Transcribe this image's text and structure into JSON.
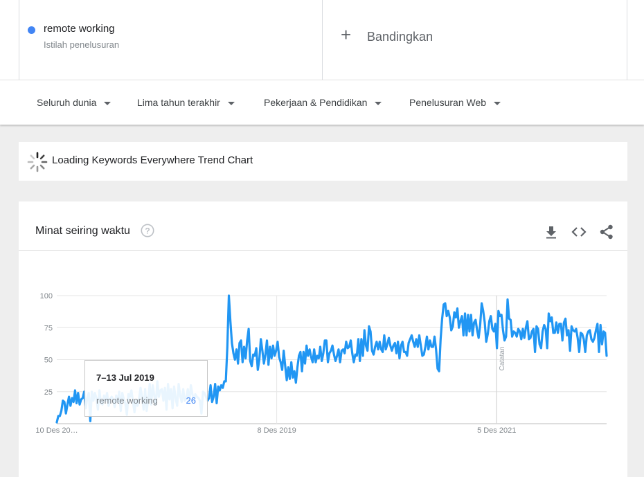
{
  "search_term": {
    "name": "remote working",
    "subtitle": "Istilah penelusuran",
    "dot_color": "#4285f4"
  },
  "compare": {
    "label": "Bandingkan",
    "icon": "plus-icon"
  },
  "filters": [
    {
      "label": "Seluruh dunia"
    },
    {
      "label": "Lima tahun terakhir"
    },
    {
      "label": "Pekerjaan & Pendidikan"
    },
    {
      "label": "Penelusuran Web"
    }
  ],
  "extension_banner": {
    "text": "Loading Keywords Everywhere Trend Chart",
    "icon": "loading-spinner-icon"
  },
  "chart_card": {
    "title": "Minat seiring waktu",
    "help_icon": "help-icon",
    "actions": [
      "download-icon",
      "embed-code-icon",
      "share-icon"
    ]
  },
  "tooltip": {
    "date": "7–13 Jul 2019",
    "term": "remote working",
    "value": "26"
  },
  "chart_data": {
    "type": "line",
    "title": "",
    "xlabel": "",
    "ylabel": "",
    "ylim": [
      0,
      100
    ],
    "yticks": [
      25,
      50,
      75,
      100
    ],
    "x_tick_labels": [
      "10 Des 20…",
      "8 Des 2019",
      "5 Des 2021"
    ],
    "x_start": "2017-12-10",
    "x_end": "2022-12-04",
    "note_label": "Catatan",
    "note_date": "2021-12-05",
    "grid": true,
    "line_color": "#2196f3",
    "series": [
      {
        "name": "remote working",
        "values": [
          1,
          6,
          6,
          10,
          18,
          17,
          8,
          15,
          21,
          14,
          20,
          17,
          26,
          16,
          24,
          15,
          19,
          20,
          25,
          12,
          20,
          24,
          2,
          25,
          18,
          24,
          20,
          11,
          26,
          16,
          15,
          22,
          18,
          24,
          14,
          19,
          21,
          19,
          13,
          22,
          17,
          25,
          10,
          24,
          19,
          16,
          7,
          23,
          21,
          26,
          17,
          9,
          18,
          14,
          19,
          28,
          21,
          11,
          27,
          10,
          19,
          31,
          15,
          30,
          22,
          15,
          33,
          21,
          26,
          27,
          18,
          28,
          11,
          31,
          19,
          27,
          12,
          29,
          20,
          14,
          31,
          22,
          17,
          27,
          18,
          20,
          27,
          16,
          30,
          23,
          18,
          23,
          21,
          20,
          18,
          8,
          25,
          24,
          21,
          18,
          20,
          30,
          17,
          21,
          31,
          16,
          29,
          26,
          30,
          28,
          33,
          33,
          60,
          100,
          80,
          63,
          55,
          50,
          58,
          47,
          63,
          65,
          48,
          60,
          51,
          65,
          74,
          49,
          45,
          54,
          53,
          59,
          42,
          50,
          66,
          57,
          47,
          54,
          65,
          46,
          60,
          51,
          61,
          53,
          57,
          64,
          52,
          48,
          42,
          57,
          45,
          34,
          44,
          35,
          48,
          36,
          41,
          32,
          44,
          53,
          56,
          41,
          56,
          47,
          61,
          53,
          58,
          52,
          48,
          58,
          48,
          53,
          51,
          60,
          49,
          55,
          65,
          65,
          48,
          55,
          57,
          61,
          54,
          49,
          53,
          58,
          48,
          57,
          58,
          55,
          64,
          59,
          60,
          65,
          55,
          48,
          54,
          53,
          66,
          49,
          66,
          53,
          73,
          61,
          57,
          76,
          72,
          57,
          54,
          60,
          64,
          58,
          64,
          58,
          56,
          69,
          58,
          62,
          67,
          61,
          57,
          61,
          63,
          55,
          64,
          51,
          61,
          64,
          56,
          56,
          53,
          63,
          66,
          69,
          64,
          60,
          66,
          60,
          69,
          61,
          53,
          54,
          60,
          68,
          58,
          65,
          60,
          60,
          68,
          58,
          43,
          41,
          66,
          82,
          93,
          94,
          84,
          88,
          83,
          73,
          76,
          87,
          83,
          90,
          75,
          80,
          84,
          69,
          86,
          69,
          85,
          72,
          85,
          69,
          79,
          81,
          73,
          67,
          77,
          94,
          88,
          79,
          64,
          70,
          80,
          84,
          74,
          72,
          78,
          59,
          88,
          84,
          85,
          73,
          65,
          68,
          97,
          82,
          81,
          68,
          72,
          71,
          68,
          74,
          72,
          66,
          74,
          67,
          75,
          80,
          66,
          67,
          72,
          74,
          56,
          76,
          74,
          62,
          59,
          72,
          77,
          74,
          59,
          86,
          80,
          83,
          71,
          71,
          79,
          71,
          78,
          78,
          65,
          79,
          82,
          69,
          73,
          57,
          76,
          73,
          72,
          74,
          67,
          56,
          71,
          70,
          66,
          56,
          69,
          72,
          73,
          66,
          64,
          67,
          73,
          78,
          56,
          77,
          62,
          72,
          71,
          53
        ]
      }
    ]
  }
}
